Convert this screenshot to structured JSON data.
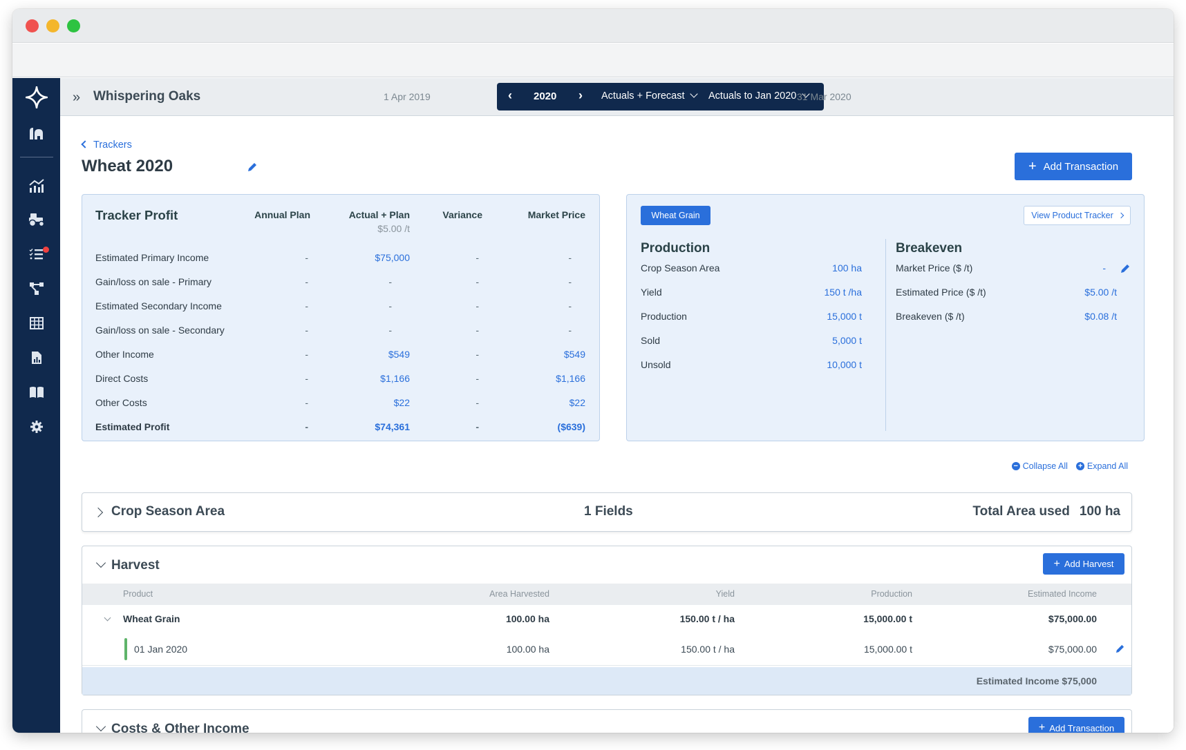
{
  "header": {
    "farm_name": "Whispering Oaks",
    "period_start": "1 Apr 2019",
    "period_end": "31 Mar 2020",
    "year": "2020",
    "mode": "Actuals + Forecast",
    "actuals_to": "Actuals to Jan 2020"
  },
  "sidebar": {
    "items": [
      {
        "icon": "logo-star-icon"
      },
      {
        "icon": "farm-icon"
      },
      {
        "icon": "chart-icon"
      },
      {
        "icon": "tractor-icon"
      },
      {
        "icon": "tasks-icon",
        "has_notification": true
      },
      {
        "icon": "workflow-icon"
      },
      {
        "icon": "table-icon"
      },
      {
        "icon": "report-icon"
      },
      {
        "icon": "book-icon"
      },
      {
        "icon": "gear-icon"
      }
    ]
  },
  "page": {
    "back_label": "Trackers",
    "title": "Wheat 2020",
    "add_transaction_label": "Add Transaction"
  },
  "tracker_profit": {
    "title": "Tracker Profit",
    "columns": [
      "Annual Plan",
      "Actual + Plan",
      "Variance",
      "Market Price"
    ],
    "actual_subheading": "$5.00 /t",
    "rows": [
      {
        "label": "Estimated Primary Income",
        "annual": "-",
        "actual": "$75,000",
        "variance": "-",
        "market": "-"
      },
      {
        "label": "Gain/loss on sale - Primary",
        "annual": "-",
        "actual": "-",
        "variance": "-",
        "market": "-"
      },
      {
        "label": "Estimated Secondary Income",
        "annual": "-",
        "actual": "-",
        "variance": "-",
        "market": "-"
      },
      {
        "label": "Gain/loss on sale - Secondary",
        "annual": "-",
        "actual": "-",
        "variance": "-",
        "market": "-"
      },
      {
        "label": "Other Income",
        "annual": "-",
        "actual": "$549",
        "variance": "-",
        "market": "$549"
      },
      {
        "label": "Direct Costs",
        "annual": "-",
        "actual": "$1,166",
        "variance": "-",
        "market": "$1,166"
      },
      {
        "label": "Other Costs",
        "annual": "-",
        "actual": "$22",
        "variance": "-",
        "market": "$22"
      },
      {
        "label": "Estimated Profit",
        "annual": "-",
        "actual": "$74,361",
        "variance": "-",
        "market": "($639)"
      }
    ]
  },
  "product_card": {
    "product_tag": "Wheat Grain",
    "view_tracker_label": "View Product Tracker",
    "production": {
      "title": "Production",
      "rows": [
        {
          "label": "Crop Season Area",
          "value": "100 ha"
        },
        {
          "label": "Yield",
          "value": "150 t /ha"
        },
        {
          "label": "Production",
          "value": "15,000 t"
        },
        {
          "label": "Sold",
          "value": "5,000 t"
        },
        {
          "label": "Unsold",
          "value": "10,000 t"
        }
      ]
    },
    "breakeven": {
      "title": "Breakeven",
      "rows": [
        {
          "label": "Market Price ($ /t)",
          "value": "-"
        },
        {
          "label": "Estimated Price ($ /t)",
          "value": "$5.00 /t"
        },
        {
          "label": "Breakeven ($ /t)",
          "value": "$0.08 /t"
        }
      ]
    }
  },
  "controls": {
    "collapse_all": "Collapse All",
    "expand_all": "Expand All"
  },
  "crop_season": {
    "title": "Crop Season Area",
    "fields": "1 Fields",
    "total_label": "Total Area used",
    "total_value": "100 ha"
  },
  "harvest": {
    "title": "Harvest",
    "add_label": "Add Harvest",
    "columns": [
      "Product",
      "Area Harvested",
      "Yield",
      "Production",
      "Estimated Income"
    ],
    "product_row": {
      "product": "Wheat Grain",
      "area": "100.00 ha",
      "yield": "150.00 t / ha",
      "production": "15,000.00 t",
      "income": "$75,000.00"
    },
    "entries": [
      {
        "date": "01 Jan 2020",
        "area": "100.00 ha",
        "yield": "150.00 t / ha",
        "production": "15,000.00 t",
        "income": "$75,000.00"
      }
    ],
    "footer": "Estimated Income $75,000"
  },
  "costs": {
    "title": "Costs & Other Income",
    "add_label": "Add Transaction"
  },
  "colors": {
    "accent": "#2a6fdb",
    "sidebar": "#10294d",
    "card_bg": "#e9f1fb",
    "notification": "#f0413f",
    "entry_marker": "#5fb46a"
  }
}
